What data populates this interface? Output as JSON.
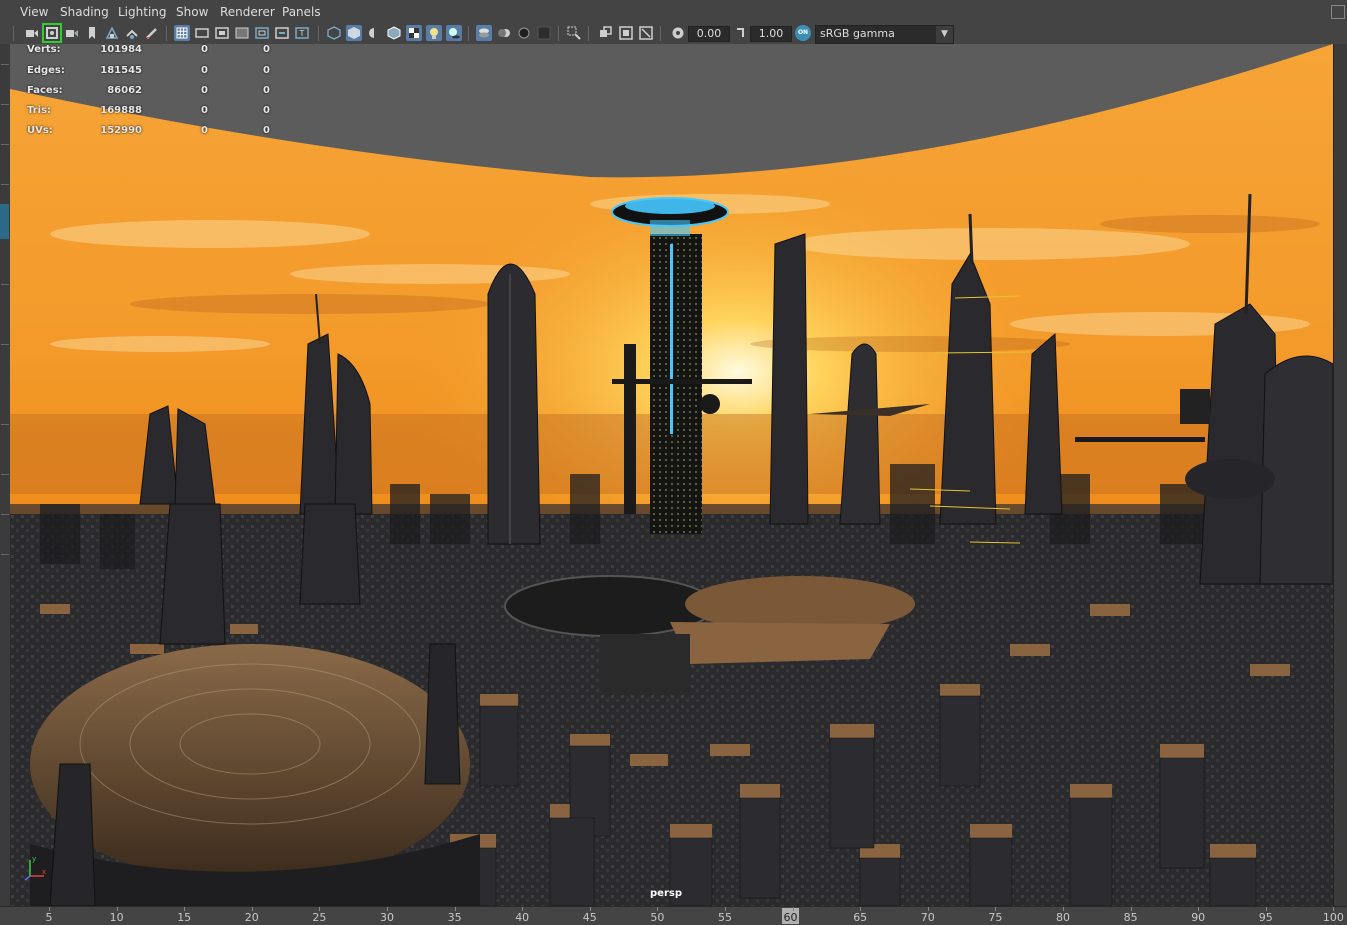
{
  "menu": [
    "View",
    "Shading",
    "Lighting",
    "Show",
    "Renderer",
    "Panels"
  ],
  "toolbar": {
    "groups": [
      [
        "camera-icon",
        "camera-attributes-icon",
        "bookmark-camera-icon",
        "bookmark-icon",
        "image-plane-icon",
        "two-d-pan-zoom-icon",
        "grease-pencil-icon"
      ],
      [
        "grid-icon",
        "film-gate-icon",
        "resolution-gate-icon",
        "gate-mask-icon",
        "field-chart-icon",
        "safe-action-icon",
        "safe-title-icon"
      ],
      [
        "wireframe-icon",
        "smooth-shade-icon",
        "bounding-box-icon",
        "wireframe-on-shaded-icon",
        "textured-icon",
        "use-all-lights-icon",
        "shadows-icon"
      ],
      [
        "screen-space-ao-icon",
        "motion-blur-icon",
        "anti-aliasing-icon",
        "depth-of-field-icon"
      ],
      [
        "isolate-select-icon",
        "xray-icon",
        "xray-joints-icon",
        "xray-active-components-icon"
      ],
      [
        "exposure-icon",
        "gamma-icon",
        "color-management-icon"
      ]
    ],
    "exposure_value": "0.00",
    "gamma_value": "1.00",
    "color_management_badge": "ON",
    "color_space": "sRGB gamma"
  },
  "hud": [
    {
      "label": "Verts:",
      "v1": "101984",
      "v2": "0",
      "v3": "0"
    },
    {
      "label": "Edges:",
      "v1": "181545",
      "v2": "0",
      "v3": "0"
    },
    {
      "label": "Faces:",
      "v1": "86062",
      "v2": "0",
      "v3": "0"
    },
    {
      "label": "Tris:",
      "v1": "169888",
      "v2": "0",
      "v3": "0"
    },
    {
      "label": "UVs:",
      "v1": "152990",
      "v2": "0",
      "v3": "0"
    }
  ],
  "camera_label": "persp",
  "axis": {
    "y": "y",
    "x": "x"
  },
  "timeline": {
    "ticks": [
      "5",
      "10",
      "15",
      "20",
      "25",
      "30",
      "35",
      "40",
      "45",
      "50",
      "55",
      "60",
      "65",
      "70",
      "75",
      "80",
      "85",
      "90",
      "95",
      "100"
    ],
    "current_frame": "60"
  },
  "colors": {
    "accent": "#5a7da8",
    "active_camera": "#2ad12a",
    "ui_bg": "#444444",
    "sky_orange": "#f08a1a",
    "sky_yellow": "#ffd24a"
  }
}
